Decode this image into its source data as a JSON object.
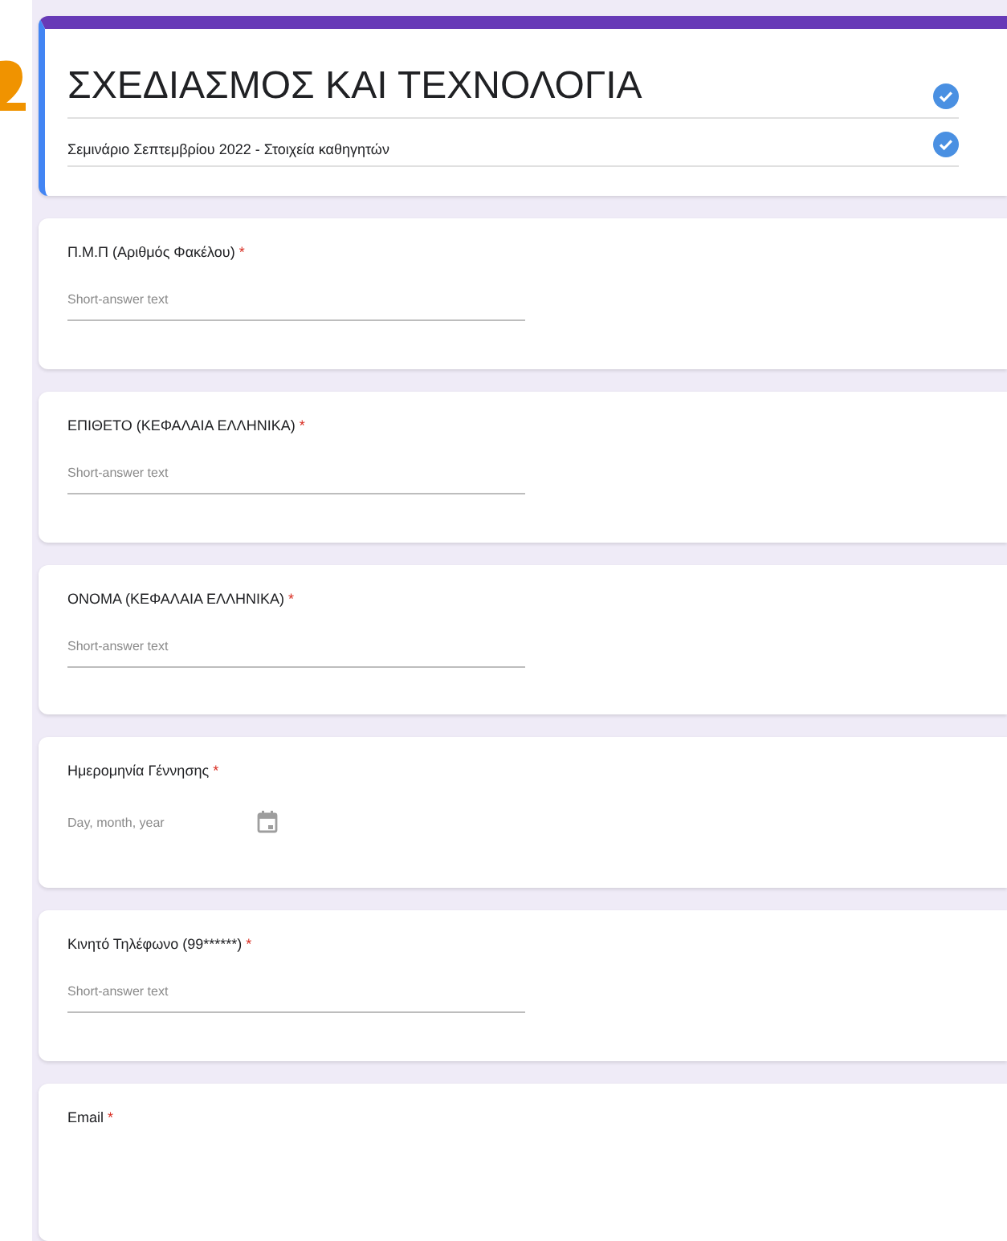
{
  "form": {
    "title": "ΣΧΕΔΙΑΣΜΟΣ ΚΑΙ ΤΕΧΝΟΛΟΓΙΑ",
    "description": "Σεμινάριο Σεπτεμβρίου 2022 - Στοιχεία καθηγητών"
  },
  "questions": [
    {
      "kind": "text",
      "label": "Π.Μ.Π (Αριθμός Φακέλου)",
      "required_mark": "*",
      "placeholder": "Short-answer text"
    },
    {
      "kind": "text",
      "label": "ΕΠΙΘΕΤΟ (ΚΕΦΑΛΑΙΑ ΕΛΛΗΝΙΚΑ)",
      "required_mark": "*",
      "placeholder": "Short-answer text"
    },
    {
      "kind": "text",
      "label": "ΟΝΟΜΑ (ΚΕΦΑΛΑΙΑ ΕΛΛΗΝΙΚΑ)",
      "required_mark": "*",
      "placeholder": "Short-answer text"
    },
    {
      "kind": "date",
      "label": "Ημερομηνία Γέννησης",
      "required_mark": "*",
      "placeholder": "Day, month, year"
    },
    {
      "kind": "text",
      "label": "Κινητό Τηλέφωνο (99******)",
      "required_mark": "*",
      "placeholder": "Short-answer text"
    },
    {
      "kind": "none",
      "label": "Email",
      "required_mark": "*"
    }
  ]
}
